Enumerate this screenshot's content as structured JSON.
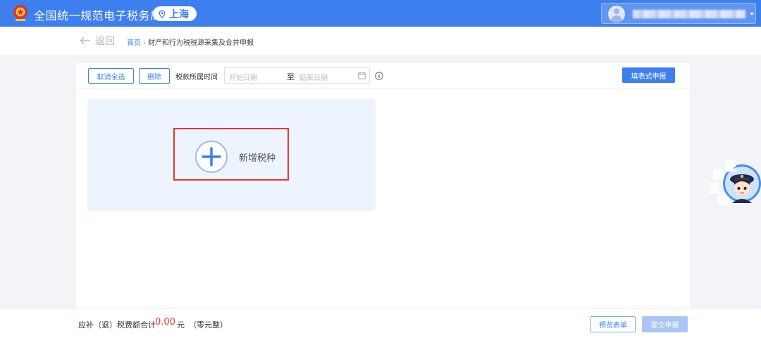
{
  "header": {
    "site_title": "全国统一规范电子税务局",
    "region": "上海",
    "logo_icon": "tax-emblem-icon",
    "region_icon": "location-pin-icon",
    "brand_color": "#3e7ff0"
  },
  "breadcrumb": {
    "back_label": "返回",
    "home": "首页",
    "separator": "›",
    "current": "财产和行为税税源采集及合并申报"
  },
  "toolbar": {
    "cancel_all_label": "取消全选",
    "delete_label": "删除",
    "period_label": "税款所属时间",
    "start_placeholder": "开始日期",
    "to_label": "至",
    "end_placeholder": "结束日期",
    "form_declare_label": "填表式申报"
  },
  "main": {
    "add_tax_label": "新增税种"
  },
  "mascot": {
    "chars": [
      "征",
      "纳",
      "互",
      "动"
    ]
  },
  "footer": {
    "total_label": "应补（退）税费额合计",
    "total_amount": "0.00",
    "total_unit": "元",
    "total_words": "（零元整）",
    "preview_label": "预览表单",
    "submit_label": "提交申报",
    "amount_color": "#e53935"
  }
}
